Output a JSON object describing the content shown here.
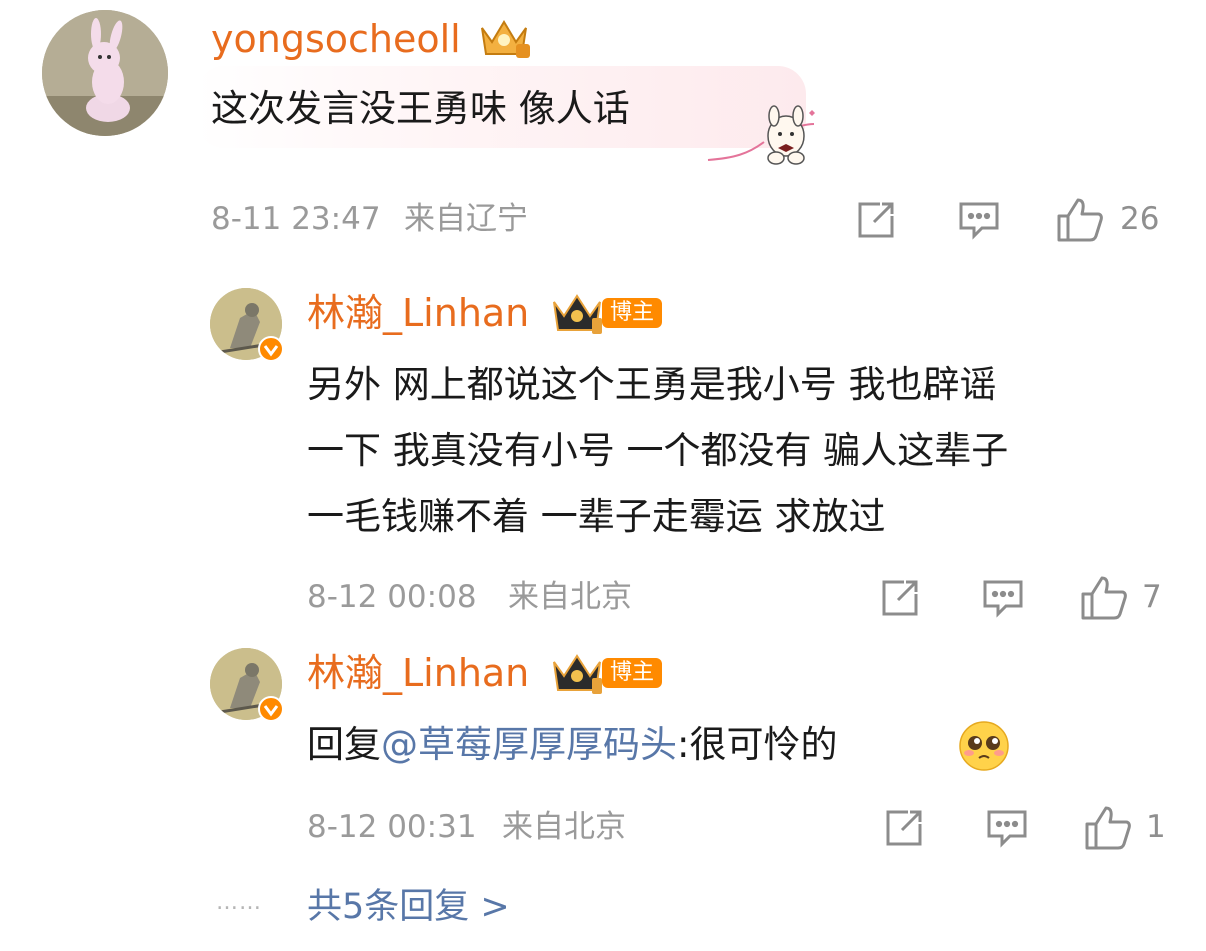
{
  "comments": [
    {
      "username": "yongsocheoll",
      "text": "这次发言没王勇味 像人话",
      "time": "8-11 23:47",
      "location": "来自辽宁",
      "likes": "26"
    },
    {
      "username": "林瀚_Linhan",
      "badge": "博主",
      "lines": [
        "另外 网上都说这个王勇是我小号 我也辟谣",
        "一下 我真没有小号 一个都没有 骗人这辈子",
        "一毛钱赚不着 一辈子走霉运 求放过"
      ],
      "time": "8-12 00:08",
      "location": "来自北京",
      "likes": "7"
    },
    {
      "username": "林瀚_Linhan",
      "badge": "博主",
      "reply_prefix": "回复",
      "mention": "@草莓厚厚厚码头",
      "reply_text": ":很可怜的",
      "time": "8-12 00:31",
      "location": "来自北京",
      "likes": "1"
    }
  ],
  "footer": {
    "dots": "……",
    "replies": "共5条回复 >"
  },
  "colors": {
    "username": "#e86c1e",
    "mention": "#5877a8",
    "meta": "#9a9a9a",
    "badge": "#ff8a00"
  },
  "icons": [
    "share-icon",
    "comment-icon",
    "like-icon",
    "crown-badge-icon",
    "verified-icon",
    "pleading-emoji-icon"
  ]
}
